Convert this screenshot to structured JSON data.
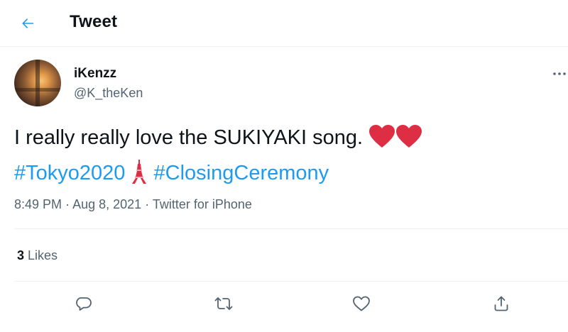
{
  "header": {
    "title": "Tweet",
    "back_icon": "arrow-left-icon"
  },
  "author": {
    "display_name": "iKenzz",
    "handle": "@K_theKen"
  },
  "tweet": {
    "text": "I really really love the SUKIYAKI song.",
    "hashtag_1": "#Tokyo2020",
    "hashtag_2": "#ClosingCeremony",
    "emojis": [
      "heart-emoji",
      "heart-emoji",
      "tokyo-tower-emoji"
    ]
  },
  "meta": {
    "time": "8:49 PM",
    "separator_1": "·",
    "date": "Aug 8, 2021",
    "separator_2": "·",
    "source": "Twitter for iPhone"
  },
  "stats": {
    "likes_count": "3",
    "likes_label": "Likes"
  },
  "actions": [
    "reply-icon",
    "retweet-icon",
    "like-icon",
    "share-icon"
  ],
  "colors": {
    "accent": "#1d9bf0",
    "text": "#0f1419",
    "secondary": "#536471",
    "divider": "#eff3f4",
    "heart": "#dd2e44"
  }
}
